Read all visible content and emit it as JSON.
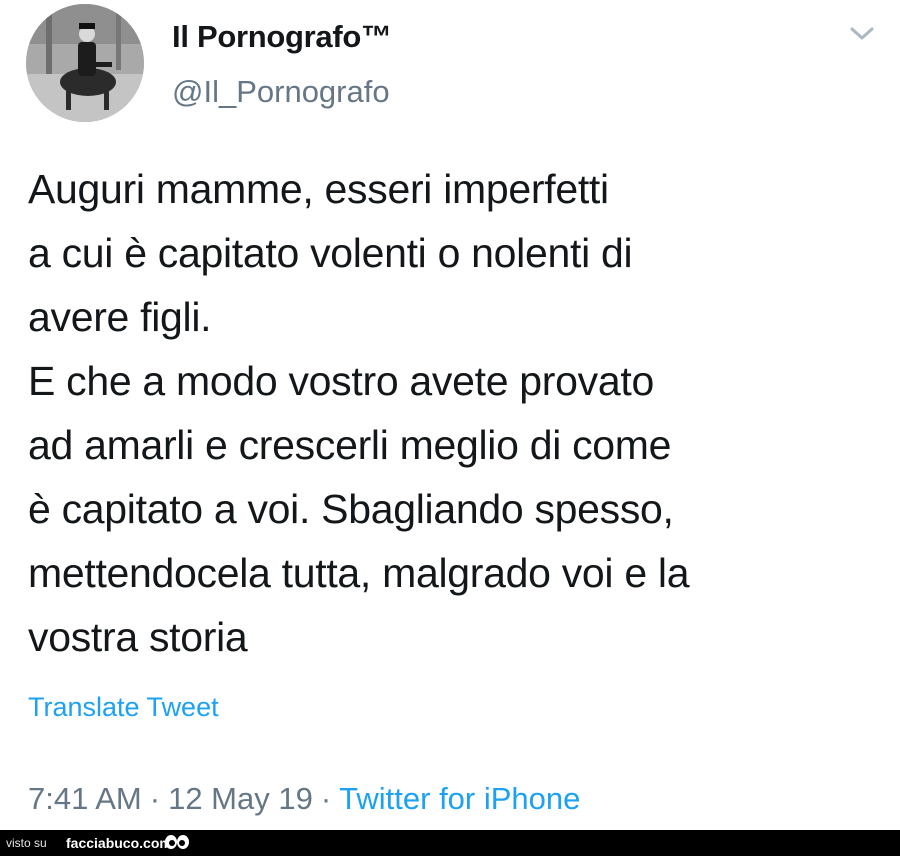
{
  "tweet": {
    "display_name": "Il Pornografo™",
    "handle": "@Il_Pornografo",
    "text": "Auguri mamme, esseri imperfetti\na cui è capitato volenti o nolenti di\navere figli.\nE che a modo vostro avete provato\nad amarli e crescerli meglio di come\nè capitato a voi. Sbagliando spesso,\nmettendocela tutta, malgrado voi e la\nvostra storia",
    "translate_label": "Translate Tweet",
    "time": "7:41 AM",
    "date": "12 May 19",
    "separator": "·",
    "source": "Twitter for iPhone"
  },
  "footer": {
    "visto_su": "visto su",
    "brand": "facciabuco.com"
  },
  "colors": {
    "text": "#14171a",
    "secondary": "#657786",
    "link": "#1da1f2",
    "footer_bg": "#000000"
  },
  "icons": {
    "avatar": "avatar-photo",
    "menu": "chevron-down-icon",
    "footer_logo": "eyes-logo"
  }
}
